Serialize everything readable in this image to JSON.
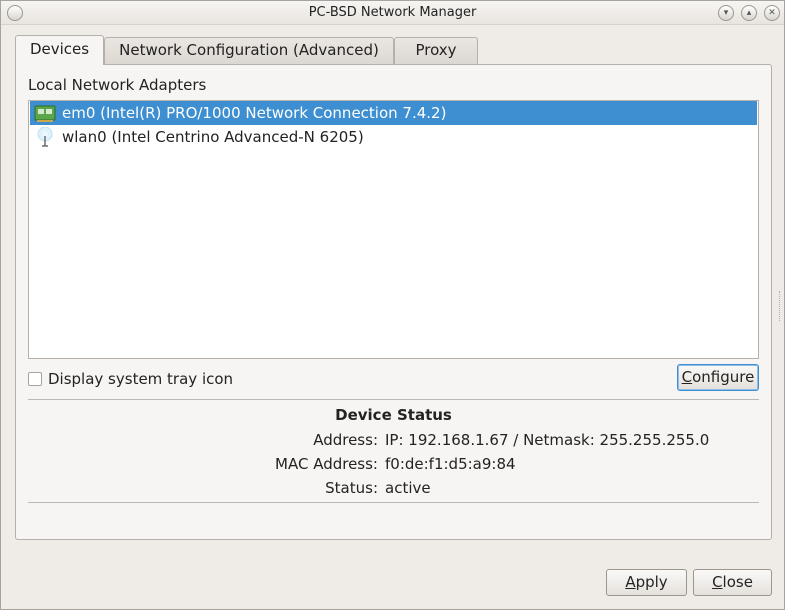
{
  "window": {
    "title": "PC-BSD Network Manager"
  },
  "tabs": [
    {
      "label": "Devices",
      "active": true
    },
    {
      "label": "Network Configuration (Advanced)",
      "active": false
    },
    {
      "label": "Proxy",
      "active": false
    }
  ],
  "devices": {
    "group_label": "Local Network Adapters",
    "adapters": [
      {
        "label": "em0 (Intel(R) PRO/1000 Network Connection 7.4.2)",
        "icon": "wired-network-card-icon",
        "selected": true
      },
      {
        "label": "wlan0 (Intel Centrino Advanced-N 6205)",
        "icon": "wireless-antenna-icon",
        "selected": false
      }
    ],
    "tray_icon_label": "Display system tray icon",
    "tray_icon_checked": false,
    "configure_label": "Configure"
  },
  "device_status": {
    "title": "Device Status",
    "rows": [
      {
        "key": "Address:",
        "value": "IP: 192.168.1.67 / Netmask: 255.255.255.0"
      },
      {
        "key": "MAC Address:",
        "value": "f0:de:f1:d5:a9:84"
      },
      {
        "key": "Status:",
        "value": "active"
      }
    ]
  },
  "footer": {
    "apply_label": "Apply",
    "close_label": "Close"
  },
  "colors": {
    "selection": "#3d8fd1",
    "window_bg": "#efebe7"
  }
}
